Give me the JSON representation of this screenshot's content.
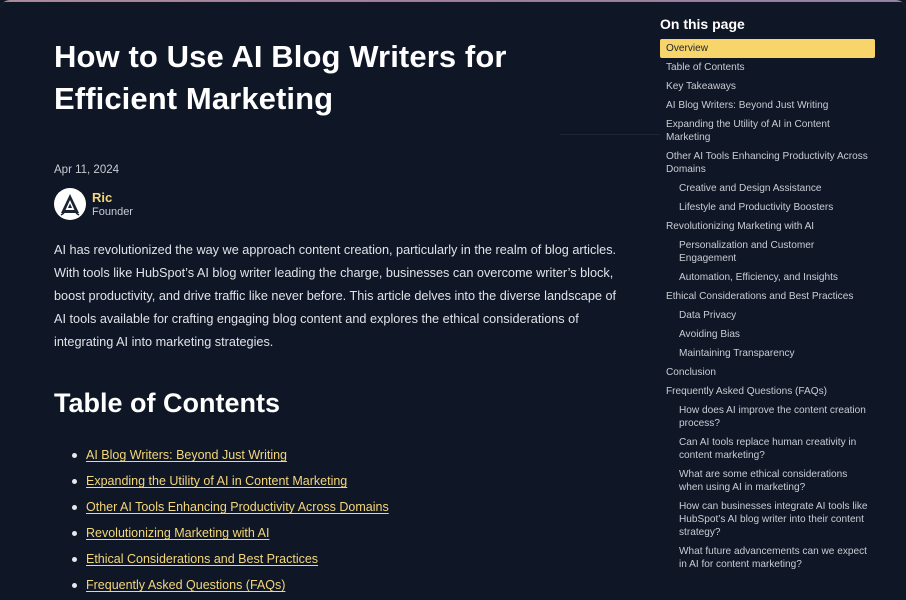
{
  "article": {
    "title": "How to Use AI Blog Writers for Efficient Marketing",
    "date": "Apr 11, 2024",
    "author": {
      "name": "Ric",
      "role": "Founder",
      "avatar_icon": "logo-triangle-icon"
    },
    "intro": "AI has revolutionized the way we approach content creation, particularly in the realm of blog articles. With tools like HubSpot’s AI blog writer leading the charge, businesses can overcome writer’s block, boost productivity, and drive traffic like never before. This article delves into the diverse landscape of AI tools available for crafting engaging blog content and explores the ethical considerations of integrating AI into marketing strategies.",
    "toc_heading": "Table of Contents",
    "toc_links": [
      "AI Blog Writers: Beyond Just Writing",
      "Expanding the Utility of AI in Content Marketing",
      "Other AI Tools Enhancing Productivity Across Domains",
      "Revolutionizing Marketing with AI",
      "Ethical Considerations and Best Practices",
      "Frequently Asked Questions (FAQs)"
    ]
  },
  "sidebar": {
    "title": "On this page",
    "items": [
      "Overview",
      "Table of Contents",
      "Key Takeaways",
      "AI Blog Writers: Beyond Just Writing",
      "Expanding the Utility of AI in Content Marketing",
      "Other AI Tools Enhancing Productivity Across Domains",
      "Creative and Design Assistance",
      "Lifestyle and Productivity Boosters",
      "Revolutionizing Marketing with AI",
      "Personalization and Customer Engagement",
      "Automation, Efficiency, and Insights",
      "Ethical Considerations and Best Practices",
      "Data Privacy",
      "Avoiding Bias",
      "Maintaining Transparency",
      "Conclusion",
      "Frequently Asked Questions (FAQs)",
      "How does AI improve the content creation process?",
      "Can AI tools replace human creativity in content marketing?",
      "What are some ethical considerations when using AI in marketing?",
      "How can businesses integrate AI tools like HubSpot’s AI blog writer into their content strategy?",
      "What future advancements can we expect in AI for content marketing?"
    ]
  },
  "colors": {
    "background": "#0f1626",
    "accent_link": "#f3d77a",
    "active_highlight": "#f8d56b"
  }
}
